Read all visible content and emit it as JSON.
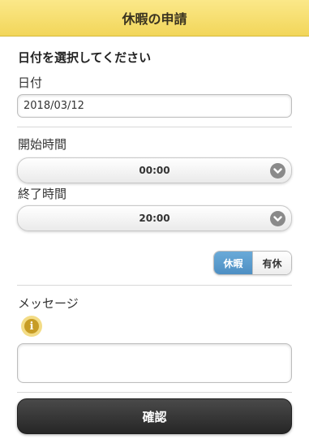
{
  "header": {
    "title": "休暇の申請"
  },
  "form": {
    "section_title": "日付を選択してください",
    "date": {
      "label": "日付",
      "value": "2018/03/12"
    },
    "start_time": {
      "label": "開始時間",
      "value": "00:00"
    },
    "end_time": {
      "label": "終了時間",
      "value": "20:00"
    },
    "leave_type": {
      "options": [
        "休暇",
        "有休"
      ],
      "selected": "休暇"
    },
    "message": {
      "label": "メッセージ",
      "value": ""
    },
    "confirm_label": "確認"
  },
  "colors": {
    "header_bg": "#f2d65a",
    "selected_option": "#5a9bd0",
    "confirm_bg": "#333333",
    "info_icon": "#c79c25"
  },
  "icons": {
    "select_arrow": "chevron-down-icon",
    "info": "info-icon"
  }
}
